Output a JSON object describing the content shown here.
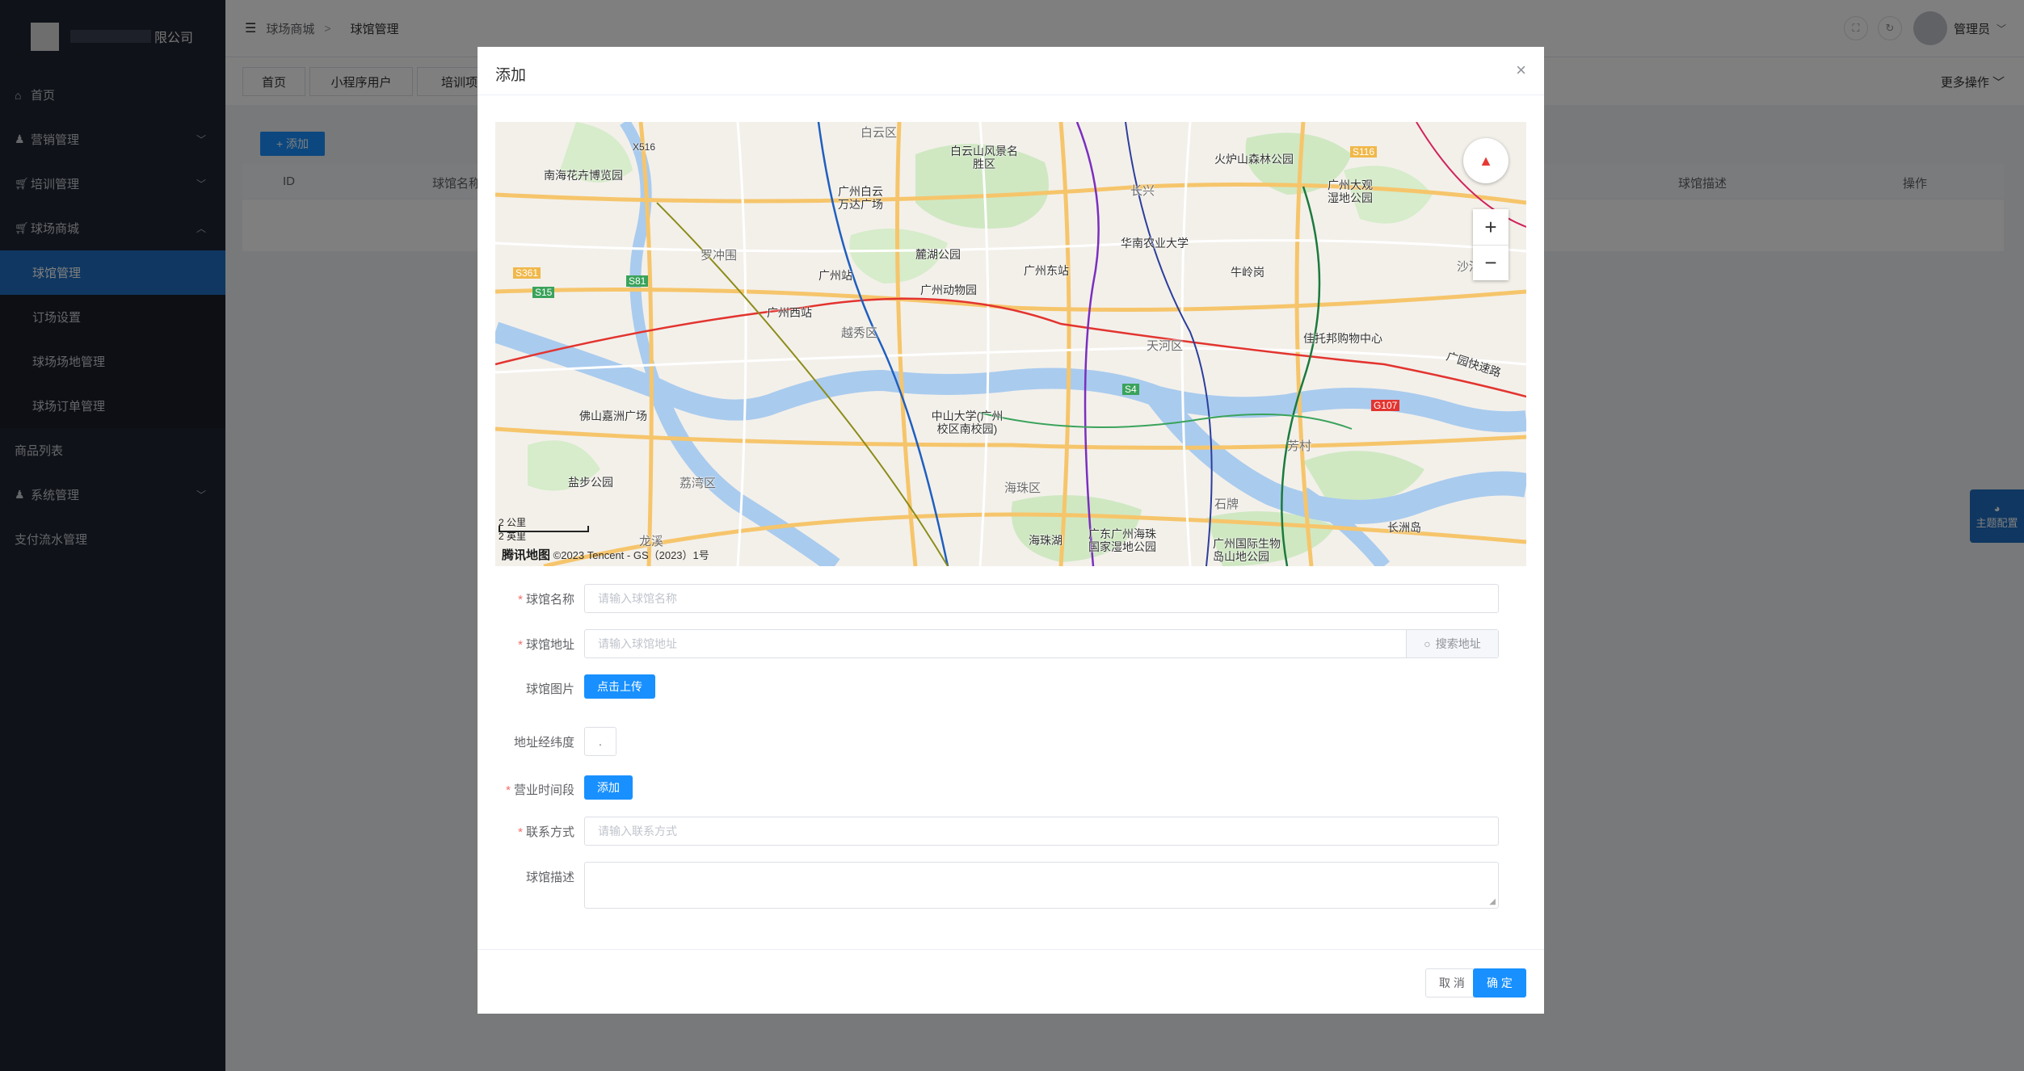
{
  "sidebar": {
    "company_suffix": "限公司",
    "menu": [
      {
        "label": "首页",
        "icon": "home-icon"
      },
      {
        "label": "营销管理",
        "icon": "users-icon"
      },
      {
        "label": "培训管理",
        "icon": "cart-icon"
      },
      {
        "label": "球场商城",
        "icon": "cart-icon"
      }
    ],
    "submenu": [
      "球馆管理",
      "订场设置",
      "球场场地管理",
      "球场订单管理"
    ],
    "menu_after": [
      {
        "label": "商品列表"
      },
      {
        "label": "系统管理",
        "icon": "users-icon"
      },
      {
        "label": "支付流水管理"
      }
    ]
  },
  "header": {
    "breadcrumb": [
      "球场商城",
      "球馆管理"
    ],
    "user": "管理员"
  },
  "tabs": [
    "首页",
    "小程序用户",
    "培训项目"
  ],
  "more_ops": "更多操作",
  "main": {
    "add_button": "+ 添加",
    "columns": [
      "ID",
      "球馆名称",
      "球馆描述",
      "操作"
    ]
  },
  "theme_config": "主题配置",
  "dialog": {
    "title": "添加",
    "map": {
      "labels": [
        "白云区",
        "白云山风景名胜区",
        "火炉山森林公园",
        "南海花卉博览园",
        "广州白云万达广场",
        "华南农业大学",
        "广州大观湿地公园",
        "罗冲围",
        "麓湖公园",
        "广州东站",
        "广州站",
        "广州动物园",
        "牛岭岗",
        "广州西站",
        "越秀区",
        "天河区",
        "佳托邦购物中心",
        "芳村",
        "佛山嘉洲广场",
        "中山大学(广州校区南校园)",
        "广园快速路",
        "盐步公园",
        "荔湾区",
        "海珠区",
        "海珠湖",
        "广东广州海珠国家湿地公园",
        "广州国际生物岛山地公园",
        "长洲岛",
        "龙溪",
        "长兴",
        "石牌",
        "沙河"
      ],
      "highways": [
        "X516",
        "S361",
        "S81",
        "S15",
        "S116",
        "S4",
        "G107"
      ],
      "scale_km": "2 公里",
      "scale_mi": "2 英里",
      "provider": "腾讯地图",
      "copyright": "©2023 Tencent - GS（2023）1号"
    },
    "form": {
      "name_label": "球馆名称",
      "name_placeholder": "请输入球馆名称",
      "address_label": "球馆地址",
      "address_placeholder": "请输入球馆地址",
      "search_button": "搜索地址",
      "image_label": "球馆图片",
      "upload_button": "点击上传",
      "coords_label": "地址经纬度",
      "coords_value": ".",
      "hours_label": "营业时间段",
      "hours_add": "添加",
      "contact_label": "联系方式",
      "contact_placeholder": "请输入联系方式",
      "desc_label": "球馆描述"
    },
    "cancel": "取 消",
    "confirm": "确 定"
  }
}
